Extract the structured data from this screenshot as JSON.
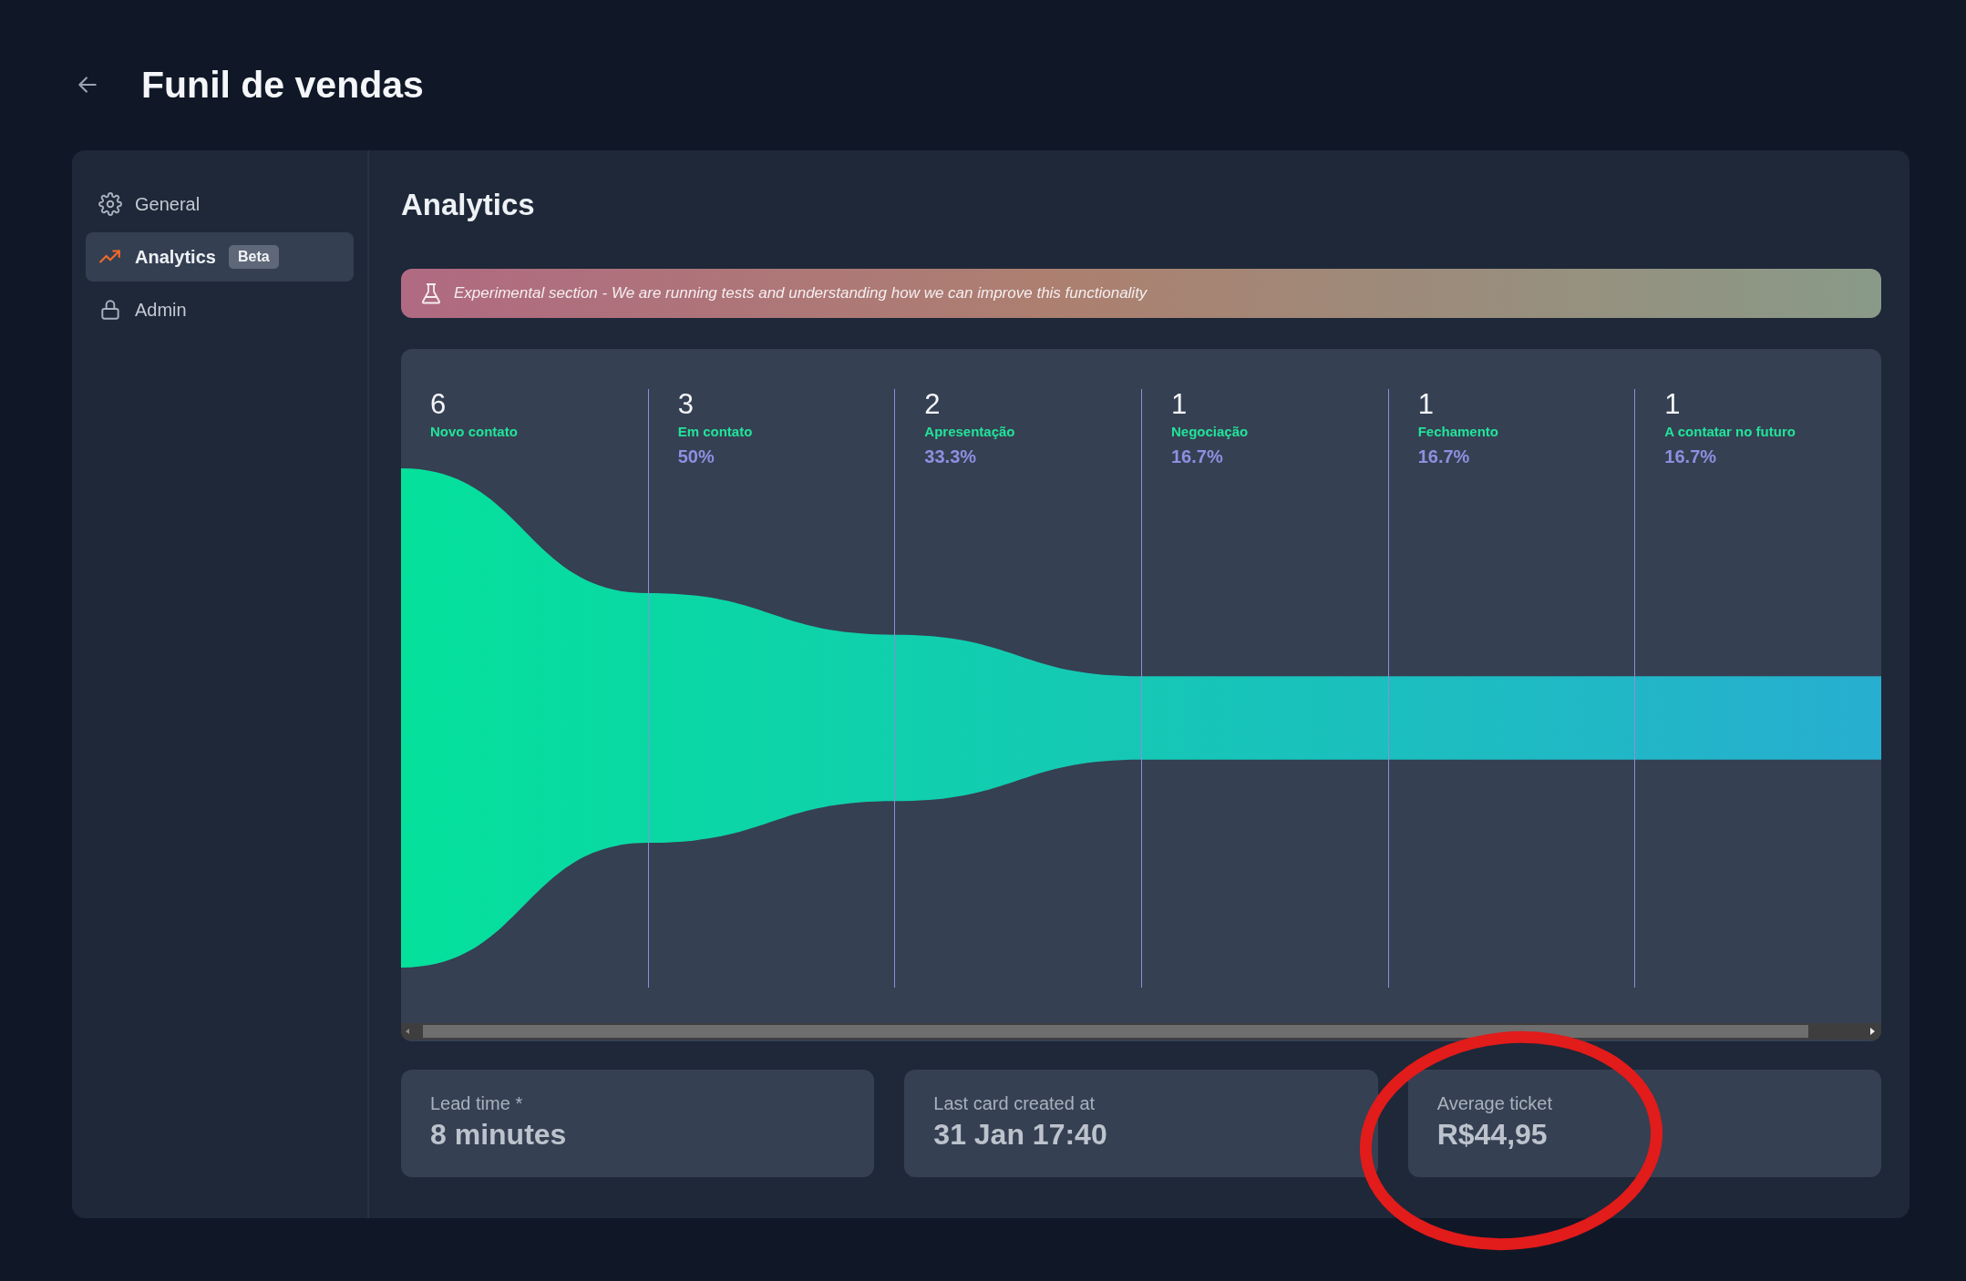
{
  "header": {
    "title": "Funil de vendas"
  },
  "sidebar": {
    "items": [
      {
        "label": "General",
        "selected": false
      },
      {
        "label": "Analytics",
        "badge": "Beta",
        "selected": true
      },
      {
        "label": "Admin",
        "selected": false
      }
    ]
  },
  "main": {
    "title": "Analytics",
    "banner": "Experimental section - We are running tests and understanding how we can improve this functionality",
    "funnel": {
      "stages": [
        {
          "count": "6",
          "name": "Novo contato"
        },
        {
          "count": "3",
          "name": "Em contato",
          "percent": "50%"
        },
        {
          "count": "2",
          "name": "Apresentação",
          "percent": "33.3%"
        },
        {
          "count": "1",
          "name": "Negociação",
          "percent": "16.7%"
        },
        {
          "count": "1",
          "name": "Fechamento",
          "percent": "16.7%"
        },
        {
          "count": "1",
          "name": "A contatar no futuro",
          "percent": "16.7%"
        }
      ]
    },
    "stats": [
      {
        "label": "Lead time *",
        "value": "8 minutes"
      },
      {
        "label": "Last card created at",
        "value": "31 Jan 17:40"
      },
      {
        "label": "Average ticket",
        "value": "R$44,95"
      }
    ]
  }
}
